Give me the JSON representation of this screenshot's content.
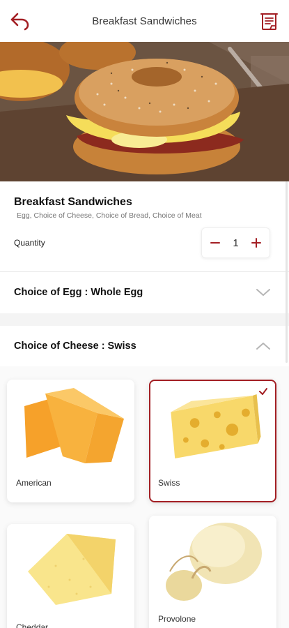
{
  "header": {
    "title": "Breakfast Sandwiches",
    "back_icon": "back-arrow-icon",
    "right_icon": "receipt-icon"
  },
  "item": {
    "name": "Breakfast Sandwiches",
    "description": "Egg, Choice of Cheese, Choice of Bread, Choice of Meat"
  },
  "quantity": {
    "label": "Quantity",
    "value": "1"
  },
  "sections": [
    {
      "title": "Choice of Egg : Whole Egg",
      "expanded": false
    },
    {
      "title": "Choice of Cheese : Swiss",
      "expanded": true
    }
  ],
  "cheese_options": [
    {
      "label": "American",
      "selected": false
    },
    {
      "label": "Swiss",
      "selected": true
    },
    {
      "label": "Cheddar",
      "selected": false
    },
    {
      "label": "Provolone",
      "selected": false
    }
  ],
  "colors": {
    "accent": "#a31f24",
    "divider": "#e6e6e6"
  }
}
